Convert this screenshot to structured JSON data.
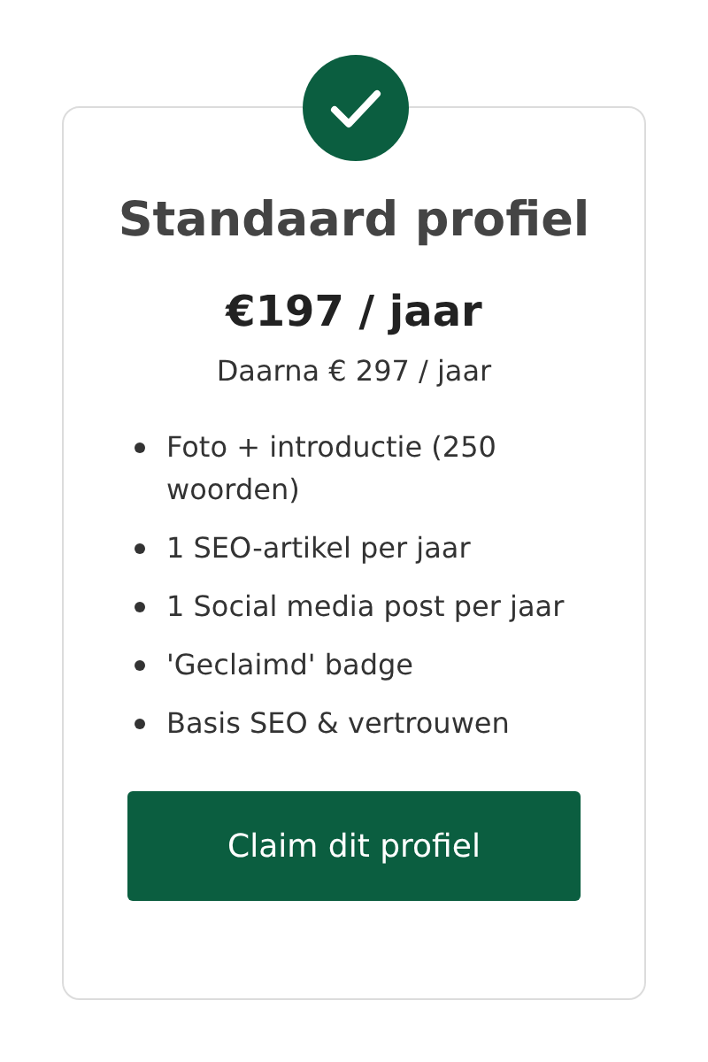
{
  "plan": {
    "title": "Standaard profiel",
    "price": "€197 / jaar",
    "renewal": "Daarna € 297 / jaar",
    "features": [
      "Foto + introductie (250 woorden)",
      "1 SEO-artikel per jaar",
      "1 Social media post per jaar",
      "'Geclaimd' badge",
      "Basis SEO & vertrouwen"
    ],
    "button": "Claim dit profiel"
  }
}
